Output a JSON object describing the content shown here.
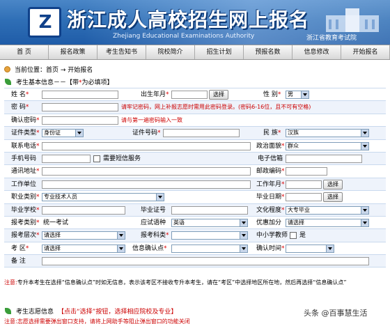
{
  "header": {
    "title": "浙江成人高校招生网上报名",
    "subtitle": "Zhejiang Educational Examinations Authority",
    "org": "浙江省教育考试院",
    "logo_text": "Z",
    "logo_icon": "zjeea-logo-icon"
  },
  "nav": [
    "首  页",
    "报名政策",
    "考生告知书",
    "院校简介",
    "招生计划",
    "预报名数",
    "信息修改",
    "开始报名"
  ],
  "breadcrumb": "当前位置：首页 → 开始报名",
  "section": {
    "title": "考生基本信息－－【带",
    "star": "*",
    "title_end": "为必填项】"
  },
  "form": {
    "name": "姓  名",
    "birth": "出生年月",
    "select_btn": "选择",
    "gender": "性  别",
    "gender_val": "男",
    "password": "密  码",
    "password_hint": "请牢记密码，网上补报志愿时需用此密码登录。(密码6-16位，且不可有空格)",
    "confirm": "确认密码",
    "confirm_hint": "请与第一遍密码输入一致",
    "idtype": "证件类型",
    "idtype_val": "身份证",
    "idno": "证件号码",
    "nation": "民  族",
    "nation_val": "汉族",
    "phone": "联系电话",
    "politics": "政治面貌",
    "politics_val": "群众",
    "mobile": "手机号码",
    "sms": "需要短信服务",
    "email": "电子信箱",
    "address": "通讯地址",
    "zip": "邮政编码",
    "company": "工作单位",
    "workyear": "工作年月",
    "job": "职业类别",
    "job_val": "专业技术人员",
    "gradyear": "毕业日期",
    "school": "毕业学校",
    "cert": "毕业证号",
    "edu": "文化程度",
    "edu_val": "大专毕业",
    "category": "报考类别",
    "category_val": "统一考试",
    "lang": "应试语种",
    "lang_val": "英语",
    "bonus": "优惠加分",
    "bonus_val": "请选择",
    "level": "报考层次",
    "level_val": "请选择",
    "subject": "报考科类",
    "subject_val": "",
    "teacher": "中小学教师",
    "teacher_val": "是",
    "area": "考  区",
    "area_val": "请选择",
    "confirm_point": "信息确认点",
    "confirm_point_val": "",
    "confirm_time": "确认时间",
    "remark": "备  注"
  },
  "note": {
    "label": "注意",
    "text": "专升本考生在选择“信息确认点”时如无信息，表示该考区不接收专升本考生，请在“考区”中选择地区所在地，然后再选择“信息确认点”"
  },
  "volunteer": {
    "title": "考生志愿信息",
    "hint": "【点击“选择”按钮，选择相应院校及专业】",
    "note": "注意:志愿选择需要弹出窗口支持，请将上网助手等阻止弹出窗口的功能关闭"
  },
  "watermark": "头条 @百事慧生活"
}
